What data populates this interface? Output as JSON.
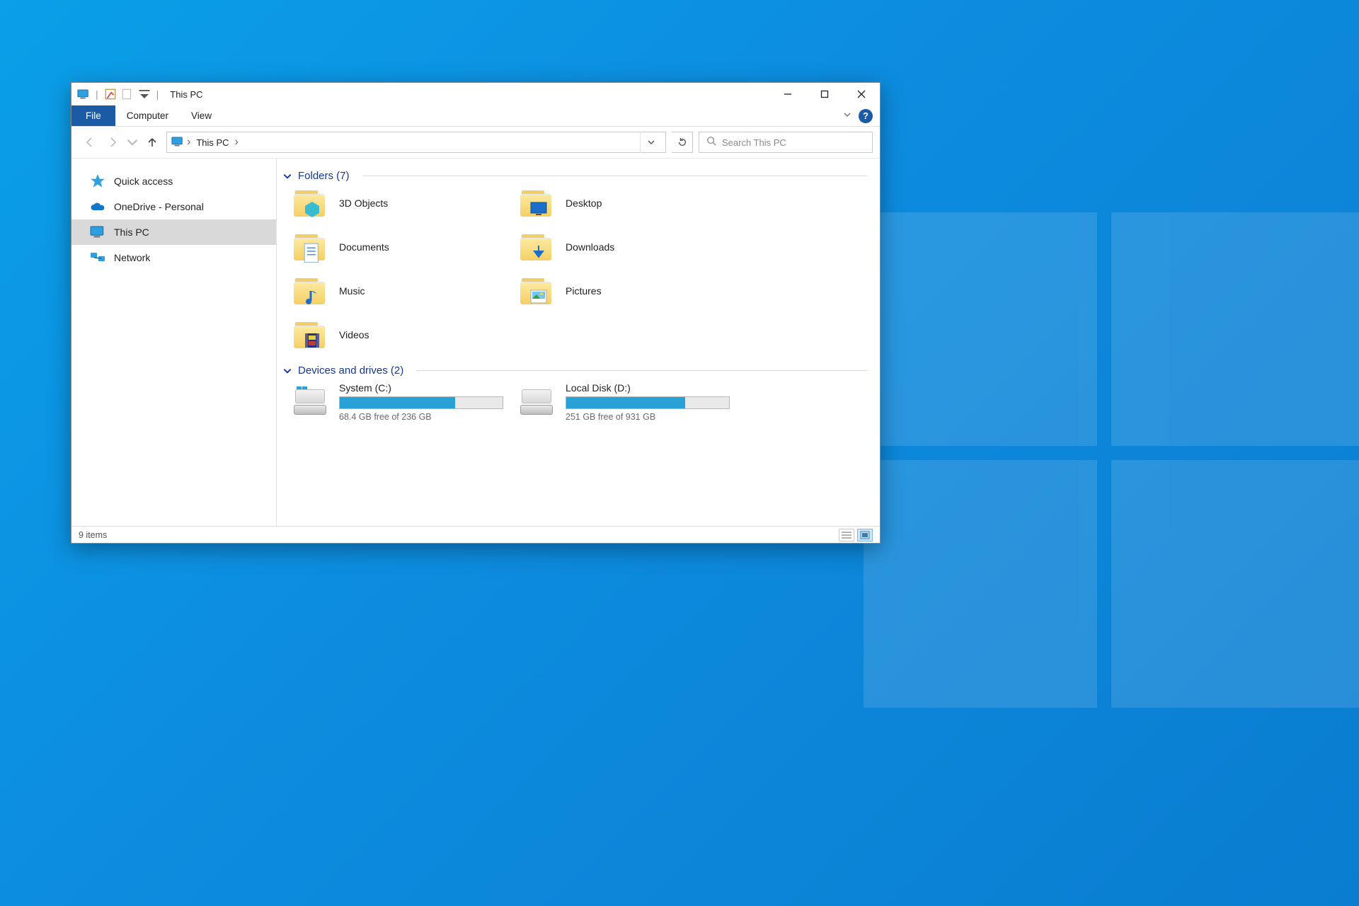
{
  "window": {
    "title": "This PC"
  },
  "ribbon": {
    "file": "File",
    "tabs": [
      "Computer",
      "View"
    ]
  },
  "address": {
    "location": "This PC"
  },
  "search": {
    "placeholder": "Search This PC"
  },
  "sidebar": {
    "items": [
      {
        "label": "Quick access"
      },
      {
        "label": "OneDrive - Personal"
      },
      {
        "label": "This PC"
      },
      {
        "label": "Network"
      }
    ]
  },
  "groups": {
    "folders": {
      "header": "Folders (7)",
      "items": [
        {
          "label": "3D Objects"
        },
        {
          "label": "Desktop"
        },
        {
          "label": "Documents"
        },
        {
          "label": "Downloads"
        },
        {
          "label": "Music"
        },
        {
          "label": "Pictures"
        },
        {
          "label": "Videos"
        }
      ]
    },
    "drives": {
      "header": "Devices and drives (2)",
      "items": [
        {
          "name": "System (C:)",
          "free_text": "68.4 GB free of 236 GB",
          "used_pct": 71
        },
        {
          "name": "Local Disk (D:)",
          "free_text": "251 GB free of 931 GB",
          "used_pct": 73
        }
      ]
    }
  },
  "status": {
    "text": "9 items"
  }
}
